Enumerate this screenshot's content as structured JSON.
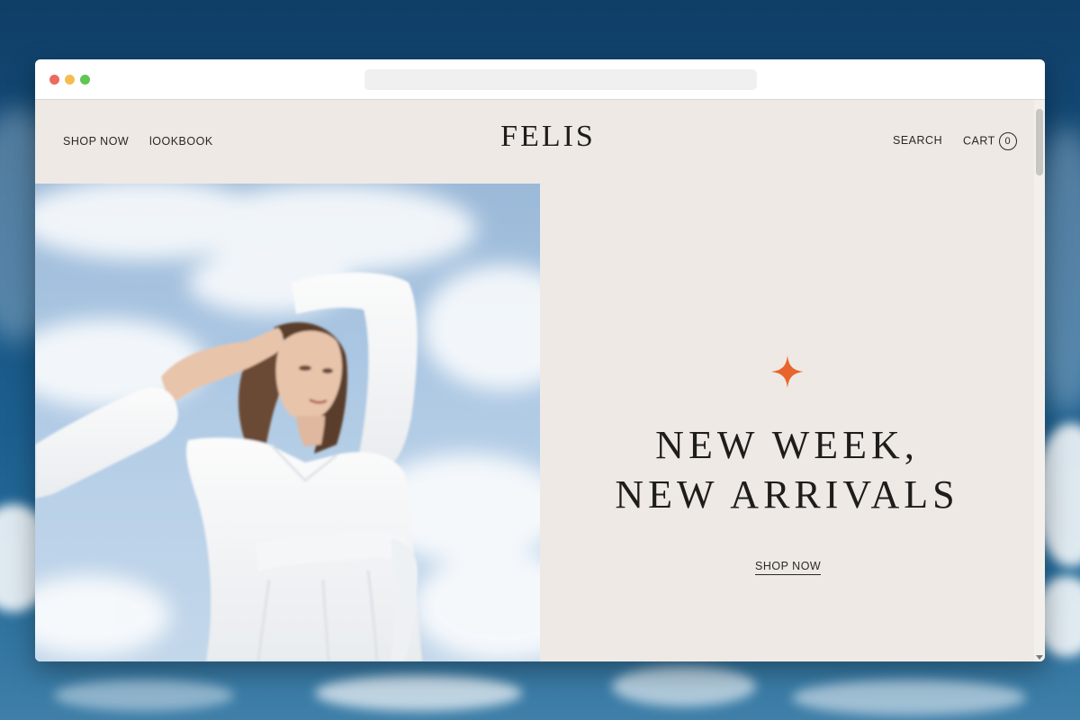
{
  "nav": {
    "left": [
      "SHOP NOW",
      "lOOKBOOK"
    ],
    "logo": "FELIS",
    "search_label": "SEARCH",
    "cart_label": "CART",
    "cart_count": "0"
  },
  "hero": {
    "headline_line1": "NEW WEEK,",
    "headline_line2": "NEW ARRIVALS",
    "cta_label": "SHOP NOW",
    "star_icon": "four-point-star-icon",
    "accent_color": "#e8642c"
  },
  "colors": {
    "page_background": "#eee9e4",
    "text": "#1f1d1b"
  }
}
